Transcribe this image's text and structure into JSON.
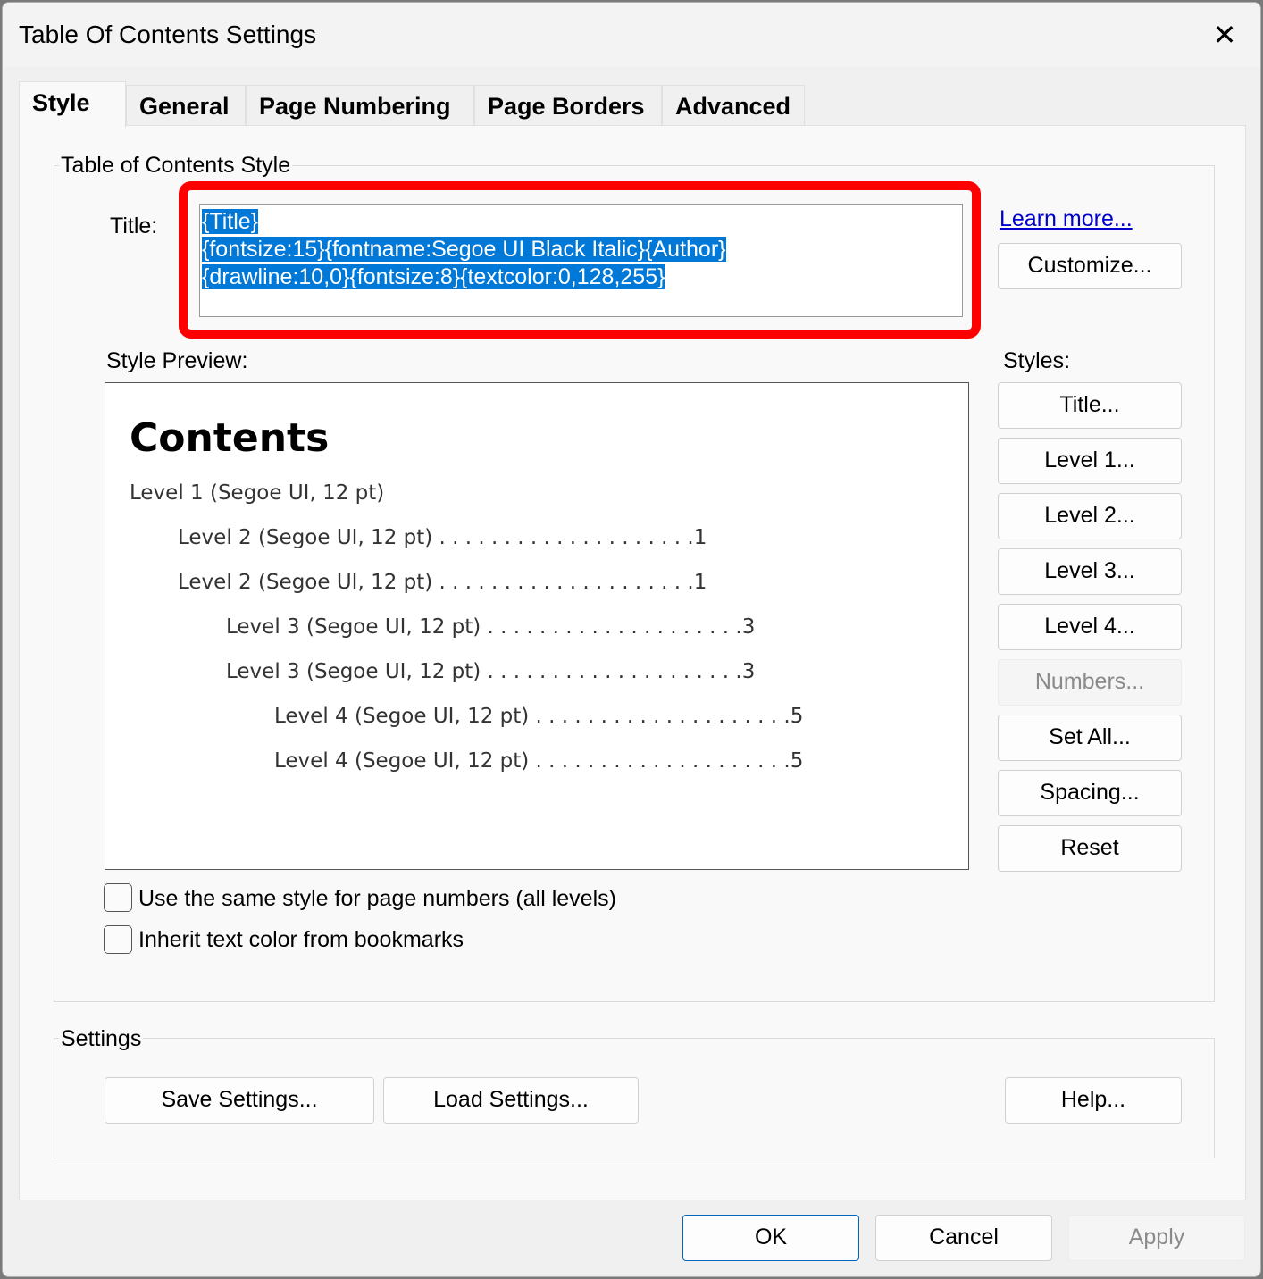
{
  "window": {
    "title": "Table Of Contents Settings",
    "close_icon": "close-icon"
  },
  "tabs": [
    {
      "label": "Style",
      "active": true
    },
    {
      "label": "General"
    },
    {
      "label": "Page Numbering"
    },
    {
      "label": "Page Borders"
    },
    {
      "label": "Advanced"
    }
  ],
  "style_group": {
    "label": "Table of Contents Style",
    "title_label": "Title:",
    "title_lines": [
      "{Title}",
      "{fontsize:15}{fontname:Segoe UI Black Italic}{Author}",
      "{drawline:10,0}{fontsize:8}{textcolor:0,128,255}"
    ],
    "highlight_color": "#ff0000",
    "selection_color": "#0078d7",
    "learn_more": "Learn more...",
    "customize": "Customize...",
    "preview_label": "Style Preview:",
    "styles_label": "Styles:",
    "preview": {
      "heading": "Contents",
      "entries": [
        {
          "text": "Level 1 (Segoe UI, 12 pt)",
          "leader": "",
          "page": ""
        },
        {
          "text": "Level 2 (Segoe UI, 12 pt)",
          "leader": " . . . . . . . . . . . . . . . . . . . .",
          "page": "1"
        },
        {
          "text": "Level 2 (Segoe UI, 12 pt)",
          "leader": " . . . . . . . . . . . . . . . . . . . .",
          "page": "1"
        },
        {
          "text": "Level 3 (Segoe UI, 12 pt)",
          "leader": " . . . . . . . . . . . . . . . . . . . .",
          "page": "3"
        },
        {
          "text": "Level 3 (Segoe UI, 12 pt)",
          "leader": " . . . . . . . . . . . . . . . . . . . .",
          "page": "3"
        },
        {
          "text": "Level 4 (Segoe UI, 12 pt)",
          "leader": " . . . . . . . . . . . . . . . . . . . .",
          "page": "5"
        },
        {
          "text": "Level 4 (Segoe UI, 12 pt)",
          "leader": " . . . . . . . . . . . . . . . . . . . .",
          "page": "5"
        }
      ]
    },
    "style_buttons": [
      {
        "label": "Title..."
      },
      {
        "label": "Level 1..."
      },
      {
        "label": "Level 2..."
      },
      {
        "label": "Level 3..."
      },
      {
        "label": "Level 4..."
      },
      {
        "label": "Numbers...",
        "disabled": true
      },
      {
        "label": "Set All..."
      },
      {
        "label": "Spacing..."
      },
      {
        "label": "Reset"
      }
    ],
    "checkboxes": [
      {
        "label": "Use the same style for page numbers (all levels)",
        "checked": false
      },
      {
        "label": "Inherit text color from bookmarks",
        "checked": false
      }
    ]
  },
  "settings_group": {
    "label": "Settings",
    "save": "Save Settings...",
    "load": "Load Settings...",
    "help": "Help..."
  },
  "footer": {
    "ok": "OK",
    "cancel": "Cancel",
    "apply": "Apply"
  }
}
